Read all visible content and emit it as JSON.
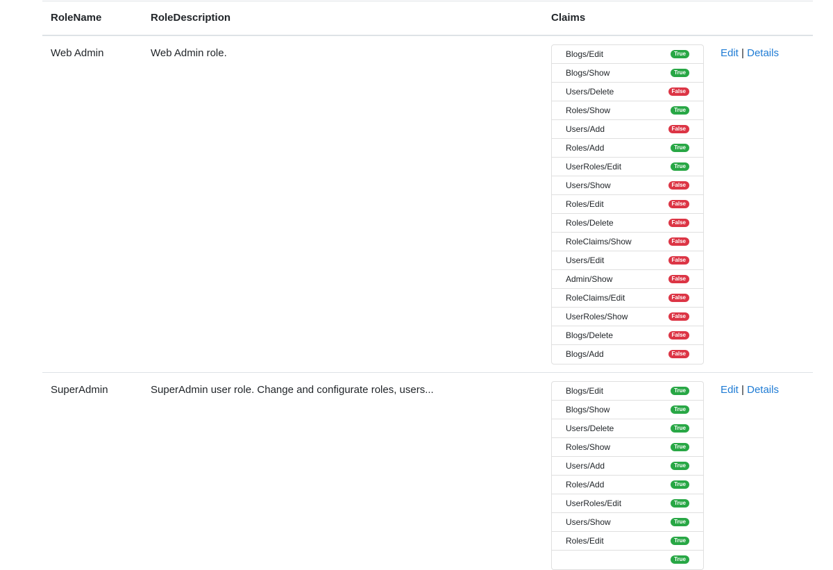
{
  "headers": {
    "role_name": "RoleName",
    "role_description": "RoleDescription",
    "claims": "Claims"
  },
  "colors": {
    "true_badge": "#28a745",
    "false_badge": "#dc3545",
    "link": "#1e7bd4"
  },
  "roles": [
    {
      "name": "Web Admin",
      "description": "Web Admin role.",
      "edit_label": "Edit",
      "separator": "|",
      "details_label": "Details",
      "claims": [
        {
          "name": "Blogs/Edit",
          "value": "True"
        },
        {
          "name": "Blogs/Show",
          "value": "True"
        },
        {
          "name": "Users/Delete",
          "value": "False"
        },
        {
          "name": "Roles/Show",
          "value": "True"
        },
        {
          "name": "Users/Add",
          "value": "False"
        },
        {
          "name": "Roles/Add",
          "value": "True"
        },
        {
          "name": "UserRoles/Edit",
          "value": "True"
        },
        {
          "name": "Users/Show",
          "value": "False"
        },
        {
          "name": "Roles/Edit",
          "value": "False"
        },
        {
          "name": "Roles/Delete",
          "value": "False"
        },
        {
          "name": "RoleClaims/Show",
          "value": "False"
        },
        {
          "name": "Users/Edit",
          "value": "False"
        },
        {
          "name": "Admin/Show",
          "value": "False"
        },
        {
          "name": "RoleClaims/Edit",
          "value": "False"
        },
        {
          "name": "UserRoles/Show",
          "value": "False"
        },
        {
          "name": "Blogs/Delete",
          "value": "False"
        },
        {
          "name": "Blogs/Add",
          "value": "False"
        }
      ]
    },
    {
      "name": "SuperAdmin",
      "description": "SuperAdmin user role. Change and configurate roles, users...",
      "edit_label": "Edit",
      "separator": "|",
      "details_label": "Details",
      "claims": [
        {
          "name": "Blogs/Edit",
          "value": "True"
        },
        {
          "name": "Blogs/Show",
          "value": "True"
        },
        {
          "name": "Users/Delete",
          "value": "True"
        },
        {
          "name": "Roles/Show",
          "value": "True"
        },
        {
          "name": "Users/Add",
          "value": "True"
        },
        {
          "name": "Roles/Add",
          "value": "True"
        },
        {
          "name": "UserRoles/Edit",
          "value": "True"
        },
        {
          "name": "Users/Show",
          "value": "True"
        },
        {
          "name": "Roles/Edit",
          "value": "True"
        },
        {
          "name": "",
          "value": "True"
        }
      ]
    }
  ]
}
